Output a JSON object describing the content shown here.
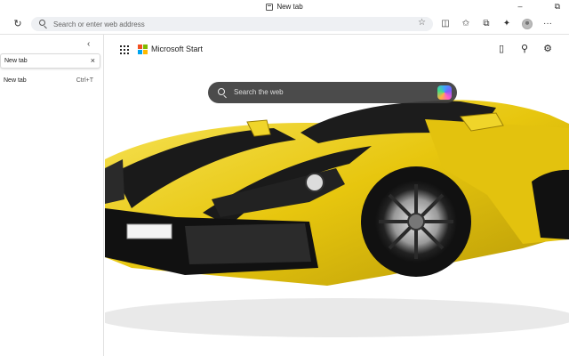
{
  "window": {
    "tab_title": "New tab",
    "minimize": "–",
    "restore": "⧉"
  },
  "toolbar": {
    "refresh_glyph": "↻",
    "address_placeholder": "Search or enter web address",
    "favorite_glyph": "☆",
    "icons": [
      "split-screen-icon",
      "favorites-icon",
      "collections-icon",
      "extensions-icon",
      "profile-icon",
      "more-icon"
    ],
    "split_glyph": "◫",
    "favorites_glyph": "✩",
    "collections_glyph": "⧉",
    "extensions_glyph": "✦",
    "more_glyph": "···"
  },
  "sidebar": {
    "collapse_glyph": "‹",
    "search_value": "New tab",
    "clear_glyph": "×",
    "tabs": [
      {
        "title": "New tab",
        "shortcut": "Ctrl+T"
      }
    ]
  },
  "newtab": {
    "brand": "Microsoft Start",
    "search_placeholder": "Search the web",
    "logo_colors": [
      "#f25022",
      "#7fba00",
      "#00a4ef",
      "#ffb900"
    ],
    "phone_glyph": "▯",
    "rewards_glyph": "⚲",
    "settings_glyph": "⚙"
  },
  "colors": {
    "car_yellow": "#f2d21a",
    "car_dark": "#1a1a1a"
  }
}
